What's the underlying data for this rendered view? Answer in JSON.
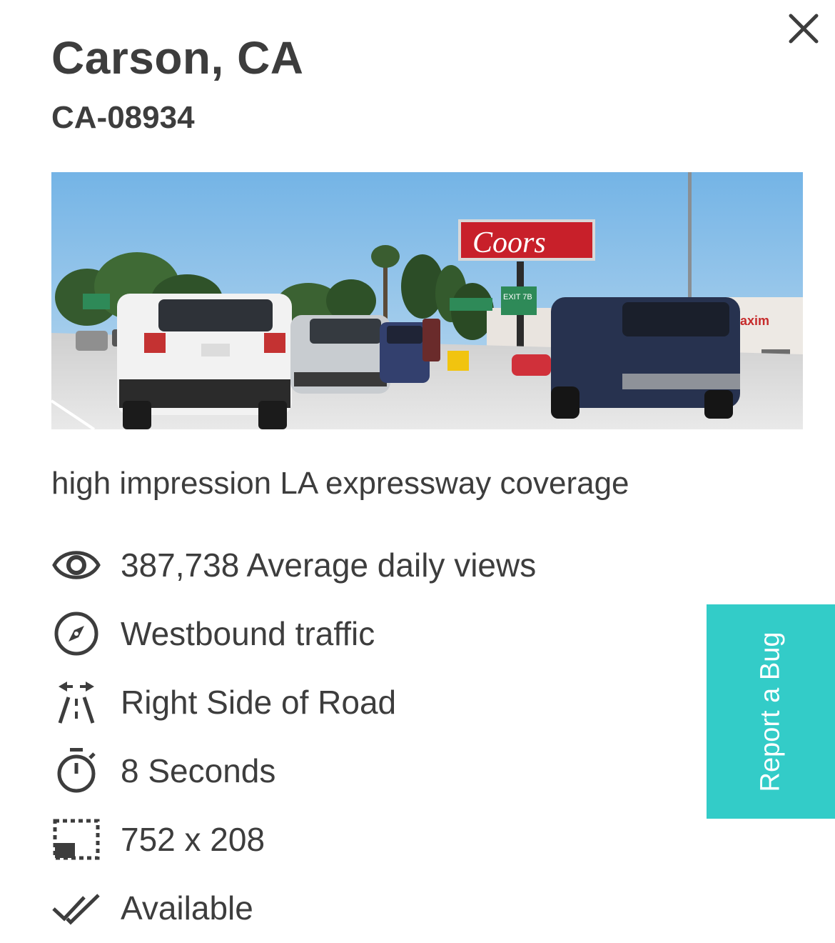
{
  "header": {
    "title": "Carson, CA",
    "code": "CA-08934"
  },
  "photo": {
    "billboard_brand": "Coors",
    "exit_sign": "EXIT 7B",
    "storefront_sign": "Maxim"
  },
  "description": "high impression LA expressway coverage",
  "specs": [
    {
      "icon": "eye-icon",
      "text": "387,738 Average daily views"
    },
    {
      "icon": "compass-icon",
      "text": "Westbound traffic"
    },
    {
      "icon": "road-side-icon",
      "text": "Right Side of Road"
    },
    {
      "icon": "stopwatch-icon",
      "text": "8 Seconds"
    },
    {
      "icon": "dimensions-icon",
      "text": "752 x 208"
    },
    {
      "icon": "double-check-icon",
      "text": "Available"
    }
  ],
  "report_bug": {
    "label": "Report a Bug",
    "color": "#33ccc8"
  },
  "colors": {
    "text": "#3d3d3d",
    "accent": "#33ccc8"
  }
}
